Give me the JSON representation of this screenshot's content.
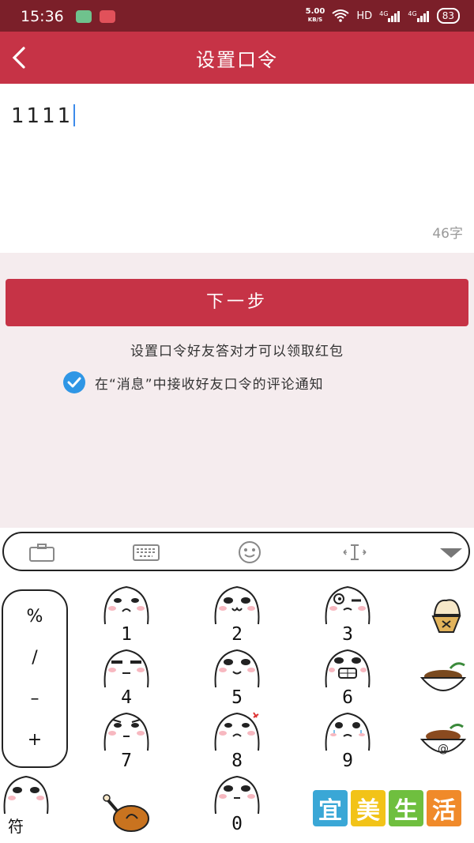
{
  "status_bar": {
    "time": "15:36",
    "net_speed": "5.00",
    "net_unit": "KB/S",
    "hd_label": "HD",
    "signal1": "4G",
    "signal2": "4G",
    "battery": "83"
  },
  "header": {
    "back_icon": "back-chevron-icon",
    "title": "设置口令"
  },
  "editor": {
    "value": "1111",
    "counter": "46字"
  },
  "actions": {
    "next_label": "下一步",
    "hint": "设置口令好友答对才可以领取红包",
    "notify_label": "在“消息”中接收好友口令的评论通知",
    "notify_checked": true
  },
  "keyboard": {
    "toolbar_icons": [
      "briefcase-icon",
      "keyboard-icon",
      "emoji-face-icon",
      "text-cursor-icon",
      "collapse-triangle-icon"
    ],
    "symbols": [
      "%",
      "/",
      "–",
      "+"
    ],
    "keys": [
      "1",
      "2",
      "3",
      "4",
      "5",
      "6",
      "7",
      "8",
      "9",
      "0"
    ],
    "bottom_left_label": "符",
    "side_icons": [
      "ice-cream-icon",
      "bowl-icon",
      "bowl-at-icon",
      "drumstick-icon"
    ]
  },
  "watermark": [
    "宜",
    "美",
    "生",
    "活"
  ],
  "colors": {
    "status_bar": "#7b1f29",
    "primary": "#c63346",
    "panel_bg": "#f5ecee",
    "check": "#2f96e5"
  }
}
